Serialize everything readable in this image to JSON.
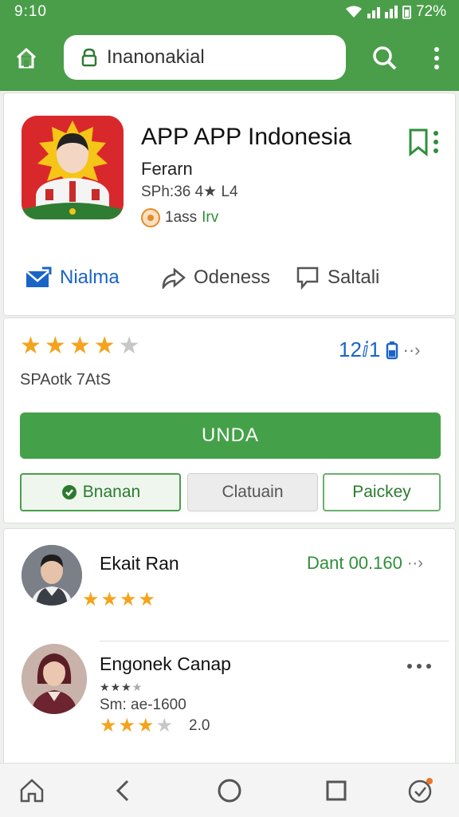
{
  "status_bar": {
    "time": "9:10",
    "battery": "72%"
  },
  "browser": {
    "url": "Inanonakial",
    "icons": {
      "home": "home-icon",
      "secure": "lock-icon",
      "search": "search-icon",
      "menu": "more-vert-icon"
    }
  },
  "app": {
    "title": "APP  APP Indonesia",
    "developer": "Ferarn",
    "size": "SPh:36",
    "size_extra": "4★ L4",
    "badge_count": "1ass",
    "badge_tag": "Irv"
  },
  "actions": {
    "items": [
      {
        "label": "Nialma",
        "icon": "mail-icon"
      },
      {
        "label": "Odeness",
        "icon": "share-icon"
      },
      {
        "label": "Saltali",
        "icon": "comment-icon"
      }
    ]
  },
  "rating": {
    "stars": 3.5,
    "stars_display": [
      "★",
      "★",
      "★",
      "★",
      "★"
    ],
    "count": "12ⅈ1",
    "label": "SPAotk 7AtS"
  },
  "buttons": {
    "primary": "UNDA",
    "secondary": [
      "Bnanan",
      "Clatuain",
      "Paickey"
    ]
  },
  "reviews": [
    {
      "name": "Ekait Ran",
      "date": "Dant 00.160",
      "stars": 4
    },
    {
      "name": "Engonek Canap",
      "meta": "Sm: ae-1600",
      "score": "2.0",
      "stars": 3,
      "mini_stars": 3
    }
  ],
  "colors": {
    "accent": "#4a9e4a",
    "link": "#1a64c8",
    "star": "#f4a31c",
    "app_icon_bg": "#d9282b"
  }
}
